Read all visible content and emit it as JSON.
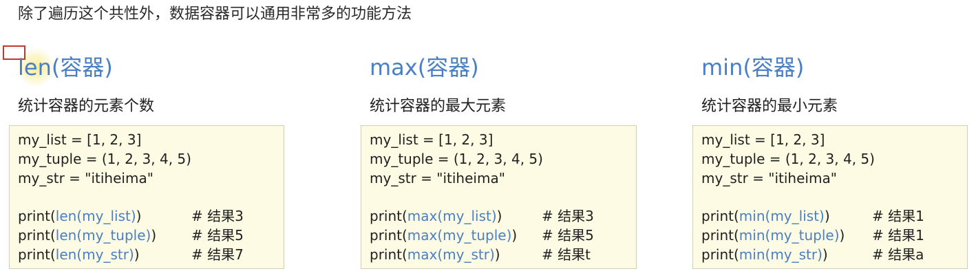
{
  "heading": "除了遍历这个共性外，数据容器可以通用非常多的功能方法",
  "columns": [
    {
      "title": "len(容器)",
      "description": "统计容器的元素个数",
      "lines": [
        "my_list = [1, 2, 3]",
        "my_tuple = (1, 2, 3, 4, 5)",
        "my_str = \"itiheima\""
      ],
      "prints": [
        {
          "pre": "print(",
          "call": "len(my_list)",
          "post": ")",
          "comment": "# 结果3"
        },
        {
          "pre": "print(",
          "call": "len(my_tuple)",
          "post": ")",
          "comment": "# 结果5"
        },
        {
          "pre": "print(",
          "call": "len(my_str)",
          "post": ")",
          "comment": "# 结果7"
        }
      ]
    },
    {
      "title": "max(容器)",
      "description": "统计容器的最大元素",
      "lines": [
        "my_list = [1, 2, 3]",
        "my_tuple = (1, 2, 3, 4, 5)",
        "my_str = \"itiheima\""
      ],
      "prints": [
        {
          "pre": "print(",
          "call": "max(my_list)",
          "post": ")",
          "comment": "# 结果3"
        },
        {
          "pre": "print(",
          "call": "max(my_tuple)",
          "post": ")",
          "comment": "# 结果5"
        },
        {
          "pre": "print(",
          "call": "max(my_str)",
          "post": ")",
          "comment": "# 结果t"
        }
      ]
    },
    {
      "title": "min(容器)",
      "description": "统计容器的最小元素",
      "lines": [
        "my_list = [1, 2, 3]",
        "my_tuple = (1, 2, 3, 4, 5)",
        "my_str = \"itiheima\""
      ],
      "prints": [
        {
          "pre": "print(",
          "call": "min(my_list)",
          "post": ")",
          "comment": "# 结果1"
        },
        {
          "pre": "print(",
          "call": "min(my_tuple)",
          "post": ")",
          "comment": "# 结果1"
        },
        {
          "pre": "print(",
          "call": "min(my_str)",
          "post": ")",
          "comment": "# 结果a"
        }
      ]
    }
  ]
}
